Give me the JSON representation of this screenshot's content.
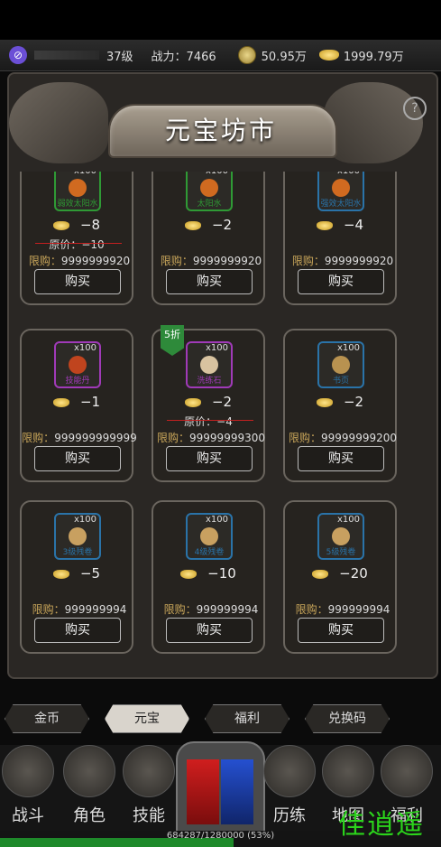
{
  "status": {
    "level": "37级",
    "power": "战力：7466",
    "gold": "50.95万",
    "yuanbao": "1999.79万"
  },
  "header": {
    "title": "元宝坊市",
    "help": "?"
  },
  "buy_label": "购买",
  "limit_label": "限购：",
  "items": [
    {
      "name": "弱效太阳水",
      "qty": "x100",
      "price": "−8",
      "orig": "原价：−10",
      "limit": "9999999920",
      "badge": "",
      "color": "#2f9a35",
      "glyph": "#d06a20"
    },
    {
      "name": "太阳水",
      "qty": "x100",
      "price": "−2",
      "orig": "",
      "limit": "9999999920",
      "badge": "",
      "color": "#2f9a35",
      "glyph": "#d06a20"
    },
    {
      "name": "强效太阳水",
      "qty": "x100",
      "price": "−4",
      "orig": "",
      "limit": "9999999920",
      "badge": "",
      "color": "#2a73a8",
      "glyph": "#d06a20"
    },
    {
      "name": "技能丹",
      "qty": "x100",
      "price": "−1",
      "orig": "",
      "limit": "999999999999",
      "badge": "",
      "color": "#a03ab8",
      "glyph": "#c0441e"
    },
    {
      "name": "洗练石",
      "qty": "x100",
      "price": "−2",
      "orig": "原价：−4",
      "limit": "99999999300",
      "badge": "5折",
      "color": "#a03ab8",
      "glyph": "#d8c3a0"
    },
    {
      "name": "书页",
      "qty": "x100",
      "price": "−2",
      "orig": "",
      "limit": "99999999200",
      "badge": "",
      "color": "#2a73a8",
      "glyph": "#b89250"
    },
    {
      "name": "3级残卷",
      "qty": "x100",
      "price": "−5",
      "orig": "",
      "limit": "999999994",
      "badge": "",
      "color": "#2a73a8",
      "glyph": "#c8a060"
    },
    {
      "name": "4级残卷",
      "qty": "x100",
      "price": "−10",
      "orig": "",
      "limit": "999999994",
      "badge": "",
      "color": "#2a73a8",
      "glyph": "#c8a060"
    },
    {
      "name": "5级残卷",
      "qty": "x100",
      "price": "−20",
      "orig": "",
      "limit": "999999994",
      "badge": "",
      "color": "#2a73a8",
      "glyph": "#c8a060"
    }
  ],
  "tabs": [
    {
      "label": "金币",
      "active": false
    },
    {
      "label": "元宝",
      "active": true
    },
    {
      "label": "福利",
      "active": false
    },
    {
      "label": "兑换码",
      "active": false
    }
  ],
  "nav": [
    {
      "label": "战斗"
    },
    {
      "label": "角色"
    },
    {
      "label": "技能"
    },
    {
      "label": "历练"
    },
    {
      "label": "地图"
    },
    {
      "label": "福利"
    }
  ],
  "exp": {
    "text": "684287/1280000 (53%)",
    "fraction": 0.53
  },
  "watermark": "佳逍遥"
}
